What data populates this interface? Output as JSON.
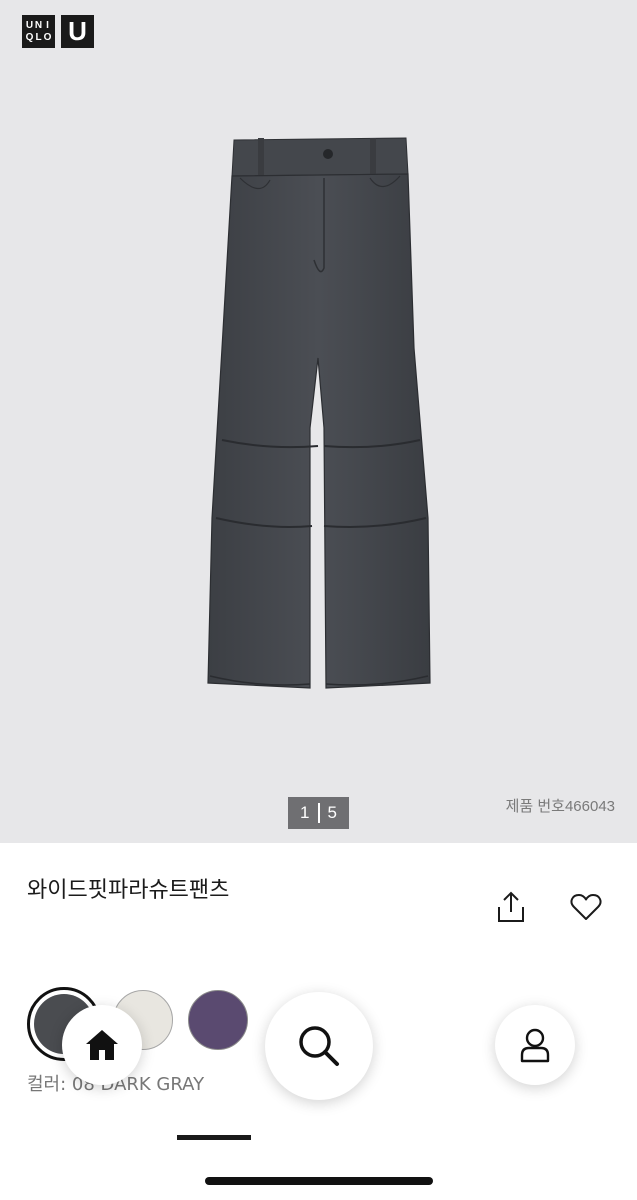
{
  "brand": {
    "logo_letters": [
      "U",
      "N",
      "I",
      "Q",
      "L",
      "O"
    ],
    "logo_u": "U",
    "colors": {
      "logo_bg": "#1a1a1a",
      "hero_bg": "#e7e7e9"
    }
  },
  "gallery": {
    "current": "1",
    "total": "5",
    "image_alt": "dark gray wide fit parachute pants"
  },
  "product": {
    "sku_text": "제품 번호466043",
    "name": "와이드핏파라슈트팬츠",
    "share_icon": "share-icon",
    "wishlist_icon": "heart-icon"
  },
  "colors": {
    "options": [
      {
        "name": "08 DARK GRAY",
        "hex": "#4a4c50",
        "selected": true
      },
      {
        "name": "light beige",
        "hex": "#e8e6e0",
        "selected": false
      },
      {
        "name": "purple",
        "hex": "#5a4a70",
        "selected": false
      }
    ],
    "label_text": "컬러: 08 DARK GRAY"
  },
  "bottom_nav": {
    "home_icon": "home-icon",
    "search_icon": "search-icon",
    "account_icon": "user-icon"
  }
}
